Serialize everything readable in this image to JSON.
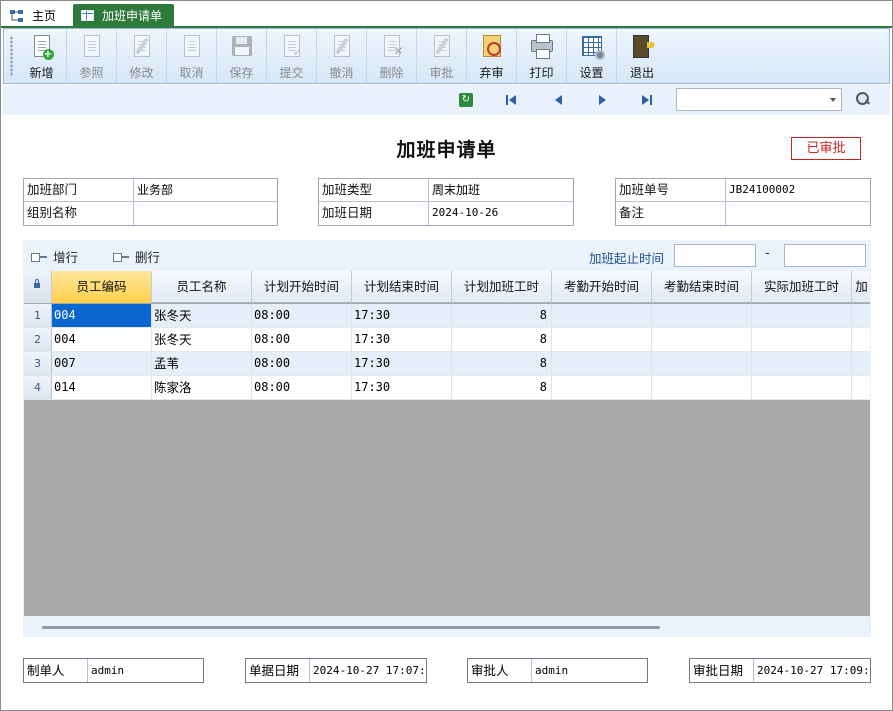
{
  "tabs": [
    {
      "label": "主页"
    },
    {
      "label": "加班申请单"
    }
  ],
  "toolbar": {
    "buttons": [
      {
        "label": "新增",
        "icon": "new-doc-icon",
        "enabled": true
      },
      {
        "label": "参照",
        "icon": "reference-icon",
        "enabled": false
      },
      {
        "label": "修改",
        "icon": "edit-icon",
        "enabled": false
      },
      {
        "label": "取消",
        "icon": "cancel-icon",
        "enabled": false
      },
      {
        "label": "保存",
        "icon": "save-icon",
        "enabled": false
      },
      {
        "label": "提交",
        "icon": "submit-icon",
        "enabled": false
      },
      {
        "label": "撤消",
        "icon": "revoke-icon",
        "enabled": false
      },
      {
        "label": "删除",
        "icon": "delete-icon",
        "enabled": false
      },
      {
        "label": "审批",
        "icon": "approve-icon",
        "enabled": false
      },
      {
        "label": "弃审",
        "icon": "unapprove-icon",
        "enabled": true
      },
      {
        "label": "打印",
        "icon": "print-icon",
        "enabled": true
      },
      {
        "label": "设置",
        "icon": "settings-icon",
        "enabled": true
      },
      {
        "label": "退出",
        "icon": "exit-icon",
        "enabled": true
      }
    ]
  },
  "nav": {
    "search_value": ""
  },
  "form": {
    "title": "加班申请单",
    "status": "已审批",
    "department_label": "加班部门",
    "department": "业务部",
    "group_label": "组别名称",
    "group": "",
    "type_label": "加班类型",
    "type": "周末加班",
    "date_label": "加班日期",
    "date": "2024-10-26",
    "number_label": "加班单号",
    "number": "JB24100002",
    "remark_label": "备注",
    "remark": ""
  },
  "grid_toolbar": {
    "add_row": "增行",
    "delete_row": "删行",
    "range_label": "加班起止时间",
    "range_from": "",
    "range_to": "",
    "range_sep": "-"
  },
  "table": {
    "columns": [
      "员工编码",
      "员工名称",
      "计划开始时间",
      "计划结束时间",
      "计划加班工时",
      "考勤开始时间",
      "考勤结束时间",
      "实际加班工时",
      "加"
    ],
    "rows": [
      {
        "no": "1",
        "code": "004",
        "name": "张冬天",
        "plan_start": "08:00",
        "plan_end": "17:30",
        "plan_hours": "8",
        "att_start": "",
        "att_end": "",
        "actual_hours": ""
      },
      {
        "no": "2",
        "code": "004",
        "name": "张冬天",
        "plan_start": "08:00",
        "plan_end": "17:30",
        "plan_hours": "8",
        "att_start": "",
        "att_end": "",
        "actual_hours": ""
      },
      {
        "no": "3",
        "code": "007",
        "name": "孟苇",
        "plan_start": "08:00",
        "plan_end": "17:30",
        "plan_hours": "8",
        "att_start": "",
        "att_end": "",
        "actual_hours": ""
      },
      {
        "no": "4",
        "code": "014",
        "name": "陈家洛",
        "plan_start": "08:00",
        "plan_end": "17:30",
        "plan_hours": "8",
        "att_start": "",
        "att_end": "",
        "actual_hours": ""
      }
    ]
  },
  "footer": {
    "maker_label": "制单人",
    "maker": "admin",
    "doc_date_label": "单据日期",
    "doc_date": "2024-10-27 17:07:2",
    "approver_label": "审批人",
    "approver": "admin",
    "approve_date_label": "审批日期",
    "approve_date": "2024-10-27 17:09:0"
  },
  "colors": {
    "tab_active": "#2d7a3a",
    "status": "#d02020",
    "selected_cell": "#0a66d0",
    "header_selected": "#ffd04a"
  }
}
